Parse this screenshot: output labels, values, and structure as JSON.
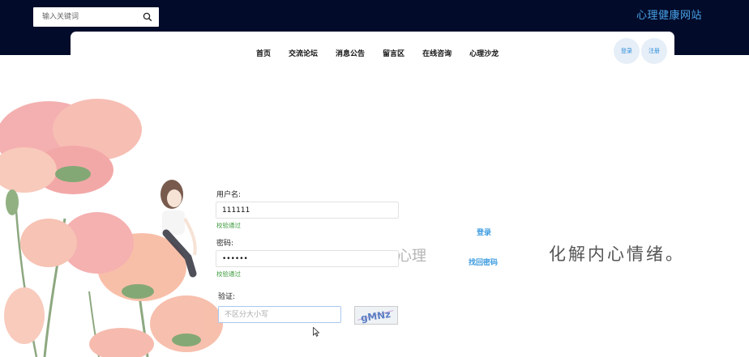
{
  "header": {
    "search_placeholder": "输入关键词",
    "site_title": "心理健康网站"
  },
  "nav": {
    "items": [
      "首页",
      "交流论坛",
      "消息公告",
      "留言区",
      "在线咨询",
      "心理沙龙"
    ],
    "login_label": "登录",
    "register_label": "注册"
  },
  "background": {
    "text_left": "心理",
    "text_right": "化解内心情绪。"
  },
  "form": {
    "username_label": "用户名:",
    "username_value": "111111",
    "username_status": "校验通过",
    "password_label": "密码:",
    "password_value": "111111",
    "password_status": "校验通过",
    "captcha_label": "验证:",
    "captcha_placeholder": "不区分大小写",
    "captcha_text": "gMNz",
    "login_label": "登录",
    "forgot_label": "找回密码"
  },
  "colors": {
    "topbar": "#020b2a",
    "accent": "#3b9be0",
    "valid": "#3c9a3c"
  }
}
